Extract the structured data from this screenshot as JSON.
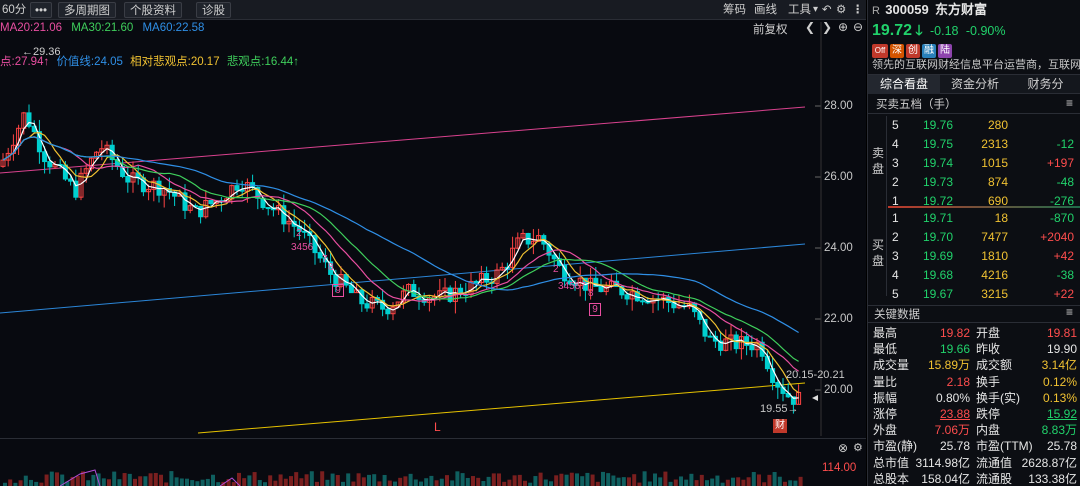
{
  "toolbar": {
    "period": "60分",
    "more": "•••",
    "multi_period": "多周期图",
    "stock_info": "个股资料",
    "diagnose": "诊股",
    "chip": "筹码",
    "draw": "画线",
    "tools": "工具",
    "rehab": "前复权"
  },
  "ma": {
    "ma20": "MA20:21.06",
    "ma30": "MA30:21.60",
    "ma60": "MA60:22.58"
  },
  "indicator": {
    "high_marker": "←29.36",
    "point1": "点:27.94↑",
    "value_line": "价值线:24.05",
    "rel_pessimistic": "相对悲观点:20.17",
    "pessimistic": "悲观点:16.44↑"
  },
  "colors": {
    "ma5": "#ffffff",
    "ma10": "#f1c232",
    "ma20": "#e94fa1",
    "ma30": "#3fcf5c",
    "ma60": "#2f8fe6",
    "up": "#ff4444",
    "down": "#00d0d0",
    "pink_line": "#d9428e",
    "blue_line": "#2b86d8",
    "yellow_line": "#e6c200"
  },
  "yaxis": {
    "ticks": [
      "28.00",
      "26.00",
      "24.00",
      "22.00",
      "20.00"
    ],
    "ticks_num": [
      28,
      26,
      24,
      22,
      20
    ]
  },
  "annotations": {
    "range_text": "20.15-20.21",
    "low_text": "19.55→",
    "low_mark": "L",
    "fin_mark": "财",
    "seq1": "2",
    "seq2": "3456",
    "seq3": "7",
    "seq4": "8",
    "seq5": "9",
    "seq6": "2",
    "seq7": "34567",
    "seq8": "8",
    "seq9": "9"
  },
  "volume": {
    "tick": "114.00"
  },
  "stock": {
    "prefix": "R",
    "code": "300059",
    "name": "东方财富",
    "price": "19.72",
    "change": "-0.18",
    "change_pct": "-0.90%",
    "tags": [
      "Off",
      "深",
      "创",
      "融",
      "陆"
    ],
    "desc": "领先的互联网财经信息平台运营商，互联网券商"
  },
  "tabs": [
    "综合看盘",
    "资金分析",
    "财务分"
  ],
  "orderbook": {
    "title": "买卖五档（手）",
    "sell_label": "卖盘",
    "buy_label": "买盘",
    "sells": [
      {
        "lvl": "5",
        "price": "19.76",
        "vol": "280",
        "chg": ""
      },
      {
        "lvl": "4",
        "price": "19.75",
        "vol": "2313",
        "chg": "-12"
      },
      {
        "lvl": "3",
        "price": "19.74",
        "vol": "1015",
        "chg": "+197"
      },
      {
        "lvl": "2",
        "price": "19.73",
        "vol": "874",
        "chg": "-48"
      },
      {
        "lvl": "1",
        "price": "19.72",
        "vol": "690",
        "chg": "-276"
      }
    ],
    "buys": [
      {
        "lvl": "1",
        "price": "19.71",
        "vol": "18",
        "chg": "-870"
      },
      {
        "lvl": "2",
        "price": "19.70",
        "vol": "7477",
        "chg": "+2040"
      },
      {
        "lvl": "3",
        "price": "19.69",
        "vol": "1810",
        "chg": "+42"
      },
      {
        "lvl": "4",
        "price": "19.68",
        "vol": "4216",
        "chg": "-38"
      },
      {
        "lvl": "5",
        "price": "19.67",
        "vol": "3215",
        "chg": "+22"
      }
    ]
  },
  "keydata": {
    "title": "关键数据",
    "rows": [
      {
        "l1": "最高",
        "v1": "19.82",
        "c1": "red",
        "l2": "开盘",
        "v2": "19.81",
        "c2": "red"
      },
      {
        "l1": "最低",
        "v1": "19.66",
        "c1": "green",
        "l2": "昨收",
        "v2": "19.90",
        "c2": "white"
      },
      {
        "l1": "成交量",
        "v1": "15.89万",
        "c1": "yellow",
        "l2": "成交额",
        "v2": "3.14亿",
        "c2": "yellow"
      },
      {
        "l1": "量比",
        "v1": "2.18",
        "c1": "red",
        "l2": "换手",
        "v2": "0.12%",
        "c2": "yellow"
      },
      {
        "l1": "振幅",
        "v1": "0.80%",
        "c1": "white",
        "l2": "换手(实)",
        "v2": "0.13%",
        "c2": "yellow"
      },
      {
        "l1": "涨停",
        "v1": "23.88",
        "c1": "red",
        "l2": "跌停",
        "v2": "15.92",
        "c2": "green"
      },
      {
        "l1": "外盘",
        "v1": "7.06万",
        "c1": "red",
        "l2": "内盘",
        "v2": "8.83万",
        "c2": "green"
      },
      {
        "l1": "市盈(静)",
        "v1": "25.78",
        "c1": "white",
        "l2": "市盈(TTM)",
        "v2": "25.78",
        "c2": "white"
      },
      {
        "l1": "总市值",
        "v1": "3114.98亿",
        "c1": "white",
        "l2": "流通值",
        "v2": "2628.87亿",
        "c2": "white"
      },
      {
        "l1": "总股本",
        "v1": "158.04亿",
        "c1": "white",
        "l2": "流通股",
        "v2": "133.38亿",
        "c2": "white"
      }
    ]
  }
}
